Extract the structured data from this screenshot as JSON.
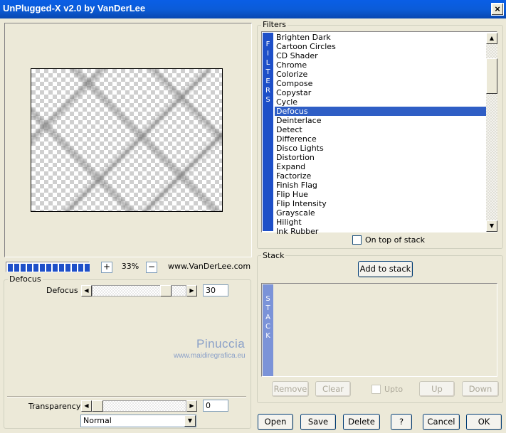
{
  "window": {
    "title": "UnPlugged-X v2.0 by VanDerLee",
    "close_label": "×"
  },
  "preview": {
    "zoom": "33%",
    "zoom_in": "+",
    "zoom_out": "−",
    "website": "www.VanDerLee.com",
    "progress_fraction": 1.0
  },
  "defocus_group": {
    "label": "Defocus",
    "slider_label": "Defocus",
    "value": "30",
    "value_fraction": 0.82
  },
  "transparency": {
    "label": "Transparency",
    "value": "0",
    "value_fraction": 0.0
  },
  "blend_mode": {
    "selected": "Normal"
  },
  "filters": {
    "label": "Filters",
    "side_letters": [
      "F",
      "I",
      "L",
      "T",
      "E",
      "R",
      "S"
    ],
    "items": [
      "Brighten Dark",
      "Cartoon Circles",
      "CD Shader",
      "Chrome",
      "Colorize",
      "Compose",
      "Copystar",
      "Cycle",
      "Defocus",
      "Deinterlace",
      "Detect",
      "Difference",
      "Disco Lights",
      "Distortion",
      "Expand",
      "Factorize",
      "Finish Flag",
      "Flip Hue",
      "Flip Intensity",
      "Grayscale",
      "Hilight",
      "Ink Rubber"
    ],
    "selected": "Defocus",
    "on_top_label": "On top of stack"
  },
  "stack": {
    "label": "Stack",
    "add_label": "Add to stack",
    "side_letters": [
      "S",
      "T",
      "A",
      "C",
      "K"
    ],
    "remove_label": "Remove",
    "clear_label": "Clear",
    "upto_label": "Upto",
    "up_label": "Up",
    "down_label": "Down"
  },
  "watermark": {
    "name": "Pinuccia",
    "url": "www.maidiregrafica.eu"
  },
  "buttons": {
    "open": "Open",
    "save": "Save",
    "delete": "Delete",
    "help": "?",
    "cancel": "Cancel",
    "ok": "OK"
  },
  "colors": {
    "title_bar": "#0a5ee6",
    "selection": "#2f5ec5",
    "filters_side": "#1e4fc8",
    "stack_side": "#7b93d8"
  }
}
